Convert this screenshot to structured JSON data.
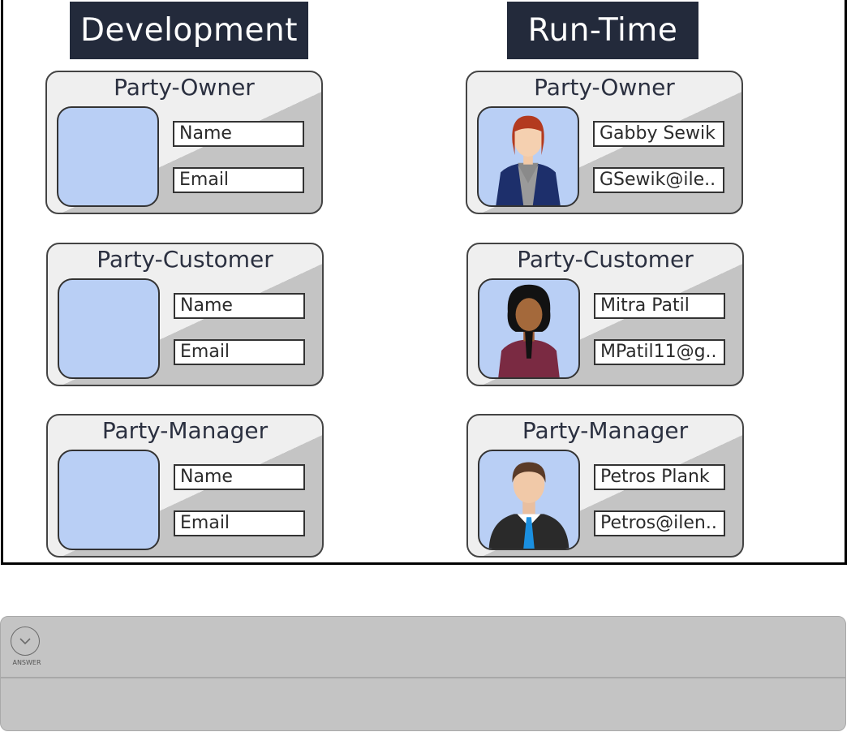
{
  "columns": {
    "development": "Development",
    "runtime": "Run-Time"
  },
  "development_cards": [
    {
      "title": "Party-Owner",
      "field1": "Name",
      "field2": "Email"
    },
    {
      "title": "Party-Customer",
      "field1": "Name",
      "field2": "Email"
    },
    {
      "title": "Party-Manager",
      "field1": "Name",
      "field2": "Email"
    }
  ],
  "runtime_cards": [
    {
      "title": "Party-Owner",
      "field1": "Gabby Sewik",
      "field2": "GSewik@ile..",
      "avatar": "woman-redhair-avatar"
    },
    {
      "title": "Party-Customer",
      "field1": "Mitra Patil",
      "field2": "MPatil11@g..",
      "avatar": "woman-braid-avatar"
    },
    {
      "title": "Party-Manager",
      "field1": "Petros Plank",
      "field2": "Petros@ilen..",
      "avatar": "man-tie-avatar"
    }
  ],
  "answer": {
    "label": "ANSWER",
    "icon": "chevron-down-icon"
  },
  "colors": {
    "header_bg": "#232a3b",
    "photo_bg": "#b9cff5",
    "card_light": "#efefef",
    "card_dark": "#c4c4c4",
    "panel_bg": "#c4c4c4"
  }
}
